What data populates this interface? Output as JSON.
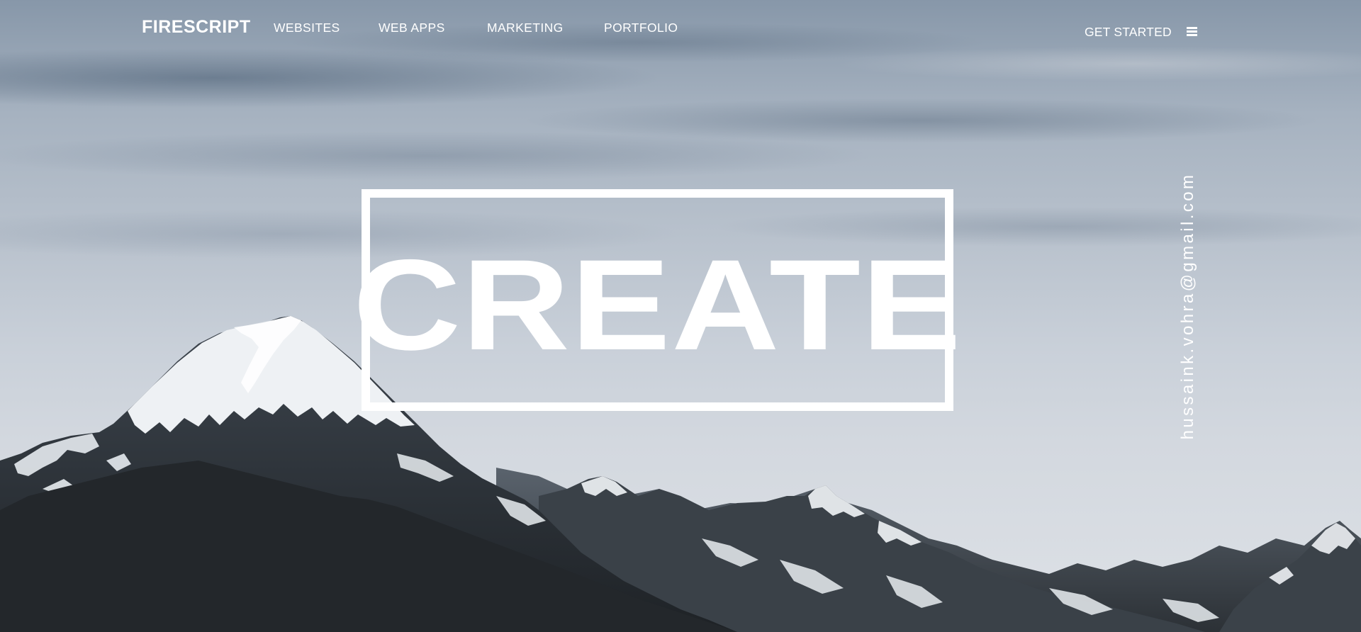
{
  "nav": {
    "brand": "FIRESCRIPT",
    "links": [
      {
        "label": "WEBSITES"
      },
      {
        "label": "WEB APPS"
      },
      {
        "label": "MARKETING"
      },
      {
        "label": "PORTFOLIO"
      }
    ],
    "cta_label": "GET STARTED",
    "menu_icon": "hamburger-menu-icon"
  },
  "hero": {
    "headline": "CREATE",
    "email": "hussaink.vohra@gmail.com"
  },
  "colors": {
    "text": "#ffffff",
    "sky_top": "#8797a9",
    "sky_bottom": "#dde1e6",
    "rock_dark": "#2b3036",
    "snow": "#eef1f4"
  }
}
